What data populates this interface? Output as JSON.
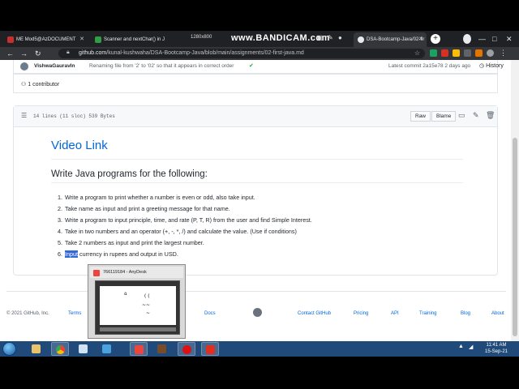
{
  "browser": {
    "tabs": [
      {
        "label": "ME Mod5@AzDOCUMENT"
      },
      {
        "label": "Scanner and nextChar() in J"
      },
      {
        "label": "DSA-Bootcamp-Java/02-fir"
      }
    ],
    "new_tab_label": "+",
    "url_domain": "github.com",
    "url_path": "/kunal-kushwaha/DSA-Bootcamp-Java/blob/main/assignments/02-first-java.md"
  },
  "recorder": {
    "resolution": "1280x800",
    "brand": "www.BANDICAM.com"
  },
  "commit": {
    "author": "VishwaGauravIn",
    "message": "Renaming file from '2' to '02' so that it appears in correct order",
    "latest": "Latest commit 2a15e78 2 days ago",
    "history_label": "History"
  },
  "contributors": "1 contributor",
  "file": {
    "info": "14 lines (11 sloc)   539 Bytes",
    "raw_label": "Raw",
    "blame_label": "Blame"
  },
  "content": {
    "heading": "Video Link",
    "subheading": "Write Java programs for the following:",
    "items": [
      {
        "num": "1.",
        "text": "Write a program to print whether a number is even or odd, also take input."
      },
      {
        "num": "2.",
        "text": "Take name as input and print a greeting message for that name."
      },
      {
        "num": "3.",
        "text": "Write a program to input principle, time, and rate (P, T, R) from the user and find Simple Interest."
      },
      {
        "num": "4.",
        "text": "Take in two numbers and an operator (+, -, *, /) and calculate the value. (Use if conditions)"
      },
      {
        "num": "5.",
        "text": "Take 2 numbers as input and print the largest number."
      }
    ],
    "item6_num": "6.",
    "item6_selected": "Input",
    "item6_rest": " currency in rupees and output in USD."
  },
  "footer": {
    "copyright": "© 2021 GitHub, Inc.",
    "links": [
      "Terms",
      "Docs",
      "Contact GitHub",
      "Pricing",
      "API",
      "Training",
      "Blog",
      "About"
    ]
  },
  "anydesk": {
    "title": "766119184 - AnyDesk"
  },
  "taskbar": {
    "time": "11:41 AM",
    "date": "15-Sep-21"
  },
  "colors": {
    "link": "#0366d6",
    "selection": "#3367d6",
    "taskbar": "#1f4a7a"
  }
}
